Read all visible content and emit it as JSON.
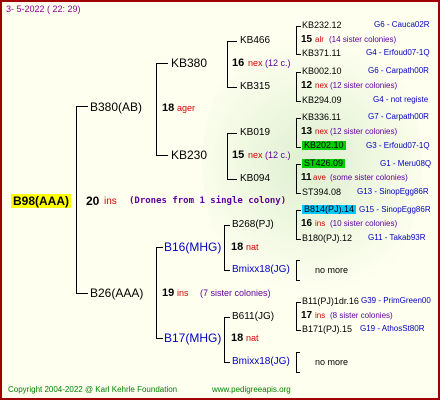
{
  "header": {
    "date": "3-   5-2022 ( 22: 29)"
  },
  "footer": {
    "copyright": "Copyright 2004-2022 @ Karl Kehrle Foundation",
    "website": "www.pedigreeapis.org"
  },
  "colors": {
    "border": "#a00000",
    "root_highlight": "#ffff00",
    "green_highlight": "#00d000",
    "cyan_highlight": "#00c8ff"
  },
  "root": {
    "name": "B98(AAA)",
    "num": "20",
    "suffix": "ins",
    "note": "(Drones from 1 single colony)"
  },
  "gen1": [
    {
      "name": "B380(AB)",
      "num": "18",
      "suffix": "ager"
    },
    {
      "name": "B26(AAA)",
      "num": "19",
      "suffix": "ins",
      "note": "(7 sister colonies)"
    }
  ],
  "gen2": [
    {
      "name": "KB380",
      "num": "16",
      "suffix": "nex",
      "note": "(12 c.)"
    },
    {
      "name": "KB230",
      "num": "15",
      "suffix": "nex",
      "note": "(12 c.)"
    },
    {
      "name": "B16(MHG)",
      "num": "18",
      "suffix": "nat"
    },
    {
      "name": "B17(MHG)",
      "num": "18",
      "suffix": "nat"
    }
  ],
  "gen3": [
    {
      "name": "KB466",
      "num": "15",
      "suffix": "alr",
      "note": "(14 sister colonies)"
    },
    {
      "name": "KB315",
      "num": "12",
      "suffix": "nex",
      "note": "(12 sister colonies)"
    },
    {
      "name": "KB019",
      "num": "13",
      "suffix": "nex",
      "note": "(12 sister colonies)"
    },
    {
      "name": "KB094",
      "num": "11",
      "suffix": "ave",
      "note": "(some sister colonies)"
    },
    {
      "name": "B268(PJ)",
      "num": "16",
      "suffix": "ins",
      "note": "(10 sister colonies)"
    },
    {
      "name": "Bmixx18(JG)",
      "more": "no more"
    },
    {
      "name": "B611(JG)",
      "num": "17",
      "suffix": "ins",
      "note": "(8 sister colonies)"
    },
    {
      "name": "Bmixx18(JG)",
      "more": "no more"
    }
  ],
  "gen4": [
    {
      "name": "KB232.12",
      "label": "G6 - Cauca02R"
    },
    {
      "name": "KB371.11",
      "label": "G4 - Erfoud07-1Q"
    },
    {
      "name": "KB002.10",
      "label": "G6 - Carpath00R"
    },
    {
      "name": "KB294.09",
      "label": "G4 - not registe"
    },
    {
      "name": "KB336.11",
      "label": "G7 - Carpath00R"
    },
    {
      "name": "KB202.10",
      "label": "G3 - Erfoud07-1Q"
    },
    {
      "name": "ST426.09",
      "label": "G1 - Meru08Q"
    },
    {
      "name": "ST394.08",
      "label": "G13 - SinopEgg86R"
    },
    {
      "name": "B814(PJ).14",
      "label": "G15 - SinopEgg86R"
    },
    {
      "name": "B180(PJ).12",
      "label": "G11 - Takab93R"
    },
    {
      "name": "B11(PJ)1dr.16",
      "label": "G39 - PrimGreen00"
    },
    {
      "name": "B171(PJ).15",
      "label": "G19 - AthosSt80R"
    }
  ]
}
